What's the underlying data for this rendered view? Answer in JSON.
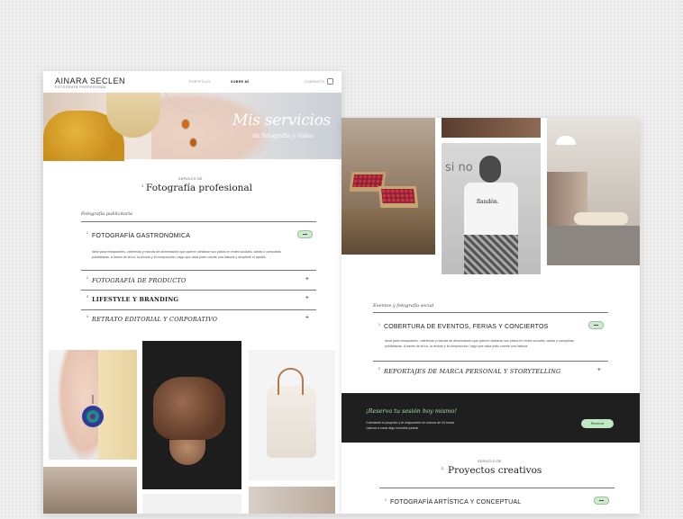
{
  "left_page": {
    "brand": "AINARA SECLEN",
    "brand_sub": "FOTÓGRAFA PROFESIONAL",
    "nav": [
      "PORTFOLIO",
      "SOBRE MÍ",
      "CONTACTO"
    ],
    "hero_title": "Mis servicios",
    "hero_subtitle": "de fotografía y video",
    "service_tag": "SERVICIO DE",
    "service_num": "1",
    "service_title": "Fotografía profesional",
    "category": "Fotografía publicitaria",
    "accordion": [
      {
        "num": "1",
        "title": "FOTOGRAFÍA GASTRONÓMICA",
        "expanded": true,
        "desc": "Ideal para restaurantes, cafeterías y marcas de alimentación que quieren destacar sus platos en redes sociales, cartas o campañas publicitarias. A través de la luz, la textura y la composición, hago que cada plato cuente una historia y despierte el apetito."
      },
      {
        "num": "2",
        "title": "FOTOGRAFÍA DE PRODUCTO",
        "expanded": false
      },
      {
        "num": "3",
        "title": "LIFESTYLE Y BRANDING",
        "expanded": false
      },
      {
        "num": "4",
        "title": "RETRATO EDITORIAL Y CORPORATIVO",
        "expanded": false
      }
    ]
  },
  "right_page": {
    "category": "Eventos y fotografía social",
    "accordion": [
      {
        "num": "1",
        "title": "COBERTURA DE EVENTOS, FERIAS Y CONCIERTOS",
        "expanded": true,
        "desc": "Ideal para restaurantes, cafeterías y marcas de alimentación que quieren destacar sus platos en redes sociales, cartas o campañas publicitarias. A través de la luz, la textura y la composición, hago que cada plato cuente una historia."
      },
      {
        "num": "2",
        "title": "REPORTAJES DE MARCA PERSONAL Y STORYTELLING",
        "expanded": false
      }
    ],
    "cta_title": "¡Reserva tu sesión hoy mismo!",
    "cta_desc_1": "Cuéntame tu proyecto y te responderé en menos de 24 horas.",
    "cta_desc_2": "¡Vamos a crear algo increíble juntos!",
    "cta_button": "Reservar",
    "service_tag": "SERVICIO DE",
    "service_num": "2",
    "service_title": "Proyectos creativos",
    "accordion2": [
      {
        "num": "1",
        "title": "FOTOGRAFÍA ARTÍSTICA Y CONCEPTUAL",
        "expanded": true
      }
    ],
    "tshirt_text": "flandón."
  },
  "colors": {
    "accent_green": "#bfe8c4",
    "dark_band": "#1f1f1f"
  },
  "icons": {
    "instagram": "instagram-icon",
    "plus": "plus-icon",
    "minus": "minus-icon"
  }
}
